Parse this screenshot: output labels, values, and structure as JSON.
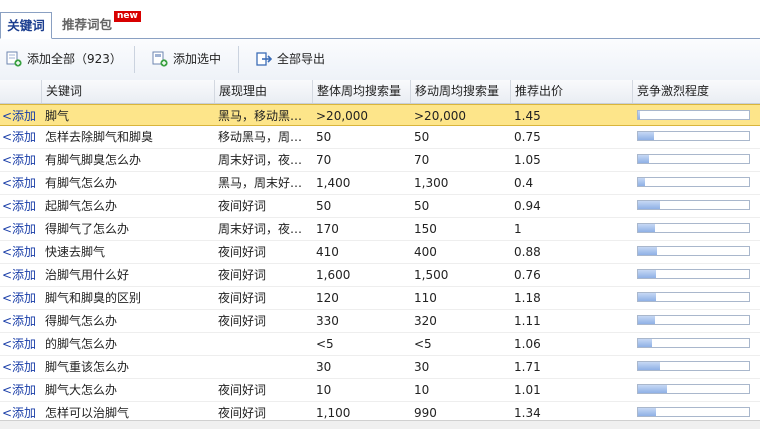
{
  "tabs": [
    {
      "label": "关键词",
      "active": true
    },
    {
      "label": "推荐词包",
      "active": false,
      "badge": "new"
    }
  ],
  "toolbar": {
    "add_all_label": "添加全部（923）",
    "add_selected_label": "添加选中",
    "export_all_label": "全部导出"
  },
  "columns": {
    "keyword": "关键词",
    "reason": "展现理由",
    "total": "整体周均搜索量",
    "mobile": "移动周均搜索量",
    "price": "推荐出价",
    "competition": "竞争激烈程度"
  },
  "add_label": "<添加",
  "rows": [
    {
      "keyword": "脚气",
      "reason": "黑马，移动黑…",
      "total": ">20,000",
      "mobile": ">20,000",
      "price": "1.45",
      "competition": 0.02,
      "selected": true
    },
    {
      "keyword": "怎样去除脚气和脚臭",
      "reason": "移动黑马，周…",
      "total": "50",
      "mobile": "50",
      "price": "0.75",
      "competition": 0.14
    },
    {
      "keyword": "有脚气脚臭怎么办",
      "reason": "周末好词，夜…",
      "total": "70",
      "mobile": "70",
      "price": "1.05",
      "competition": 0.1
    },
    {
      "keyword": "有脚气怎么办",
      "reason": "黑马，周末好…",
      "total": "1,400",
      "mobile": "1,300",
      "price": "0.4",
      "competition": 0.06
    },
    {
      "keyword": "起脚气怎么办",
      "reason": "夜间好词",
      "total": "50",
      "mobile": "50",
      "price": "0.94",
      "competition": 0.2
    },
    {
      "keyword": "得脚气了怎么办",
      "reason": "周末好词，夜…",
      "total": "170",
      "mobile": "150",
      "price": "1",
      "competition": 0.15
    },
    {
      "keyword": "快速去脚气",
      "reason": "夜间好词",
      "total": "410",
      "mobile": "400",
      "price": "0.88",
      "competition": 0.17
    },
    {
      "keyword": "治脚气用什么好",
      "reason": "夜间好词",
      "total": "1,600",
      "mobile": "1,500",
      "price": "0.76",
      "competition": 0.16
    },
    {
      "keyword": "脚气和脚臭的区别",
      "reason": "夜间好词",
      "total": "120",
      "mobile": "110",
      "price": "1.18",
      "competition": 0.16
    },
    {
      "keyword": "得脚气怎么办",
      "reason": "夜间好词",
      "total": "330",
      "mobile": "320",
      "price": "1.11",
      "competition": 0.15
    },
    {
      "keyword": "的脚气怎么办",
      "reason": "",
      "total": "<5",
      "mobile": "<5",
      "price": "1.06",
      "competition": 0.13
    },
    {
      "keyword": "脚气重该怎么办",
      "reason": "",
      "total": "30",
      "mobile": "30",
      "price": "1.71",
      "competition": 0.2
    },
    {
      "keyword": "脚气大怎么办",
      "reason": "夜间好词",
      "total": "10",
      "mobile": "10",
      "price": "1.01",
      "competition": 0.26
    },
    {
      "keyword": "怎样可以治脚气",
      "reason": "夜间好词",
      "total": "1,100",
      "mobile": "990",
      "price": "1.34",
      "competition": 0.16
    }
  ],
  "colors": {
    "selected_row": "#fde58a",
    "link": "#1a3ea8",
    "badge": "#d80000",
    "bar_fill": "#8fb1e6"
  }
}
